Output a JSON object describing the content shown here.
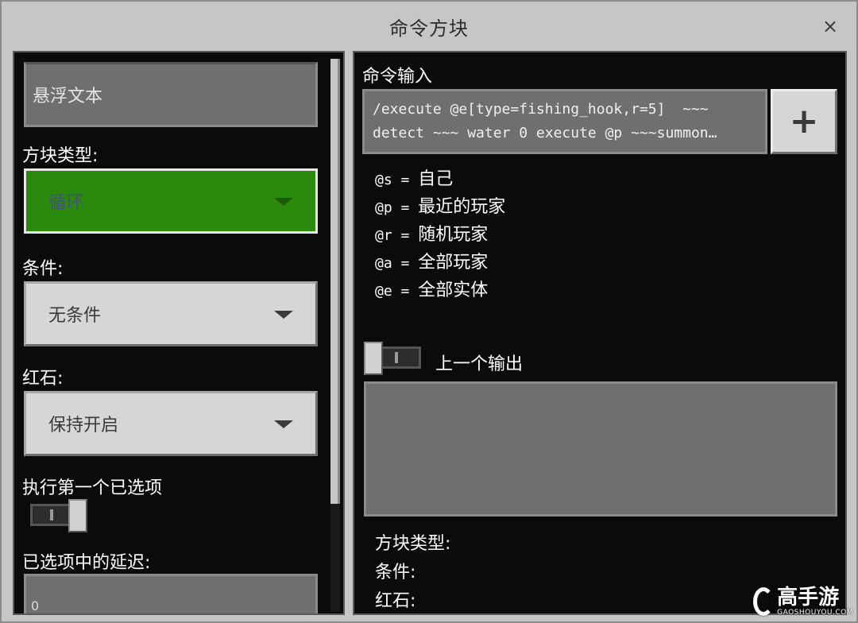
{
  "window": {
    "title": "命令方块",
    "close_glyph": "×"
  },
  "left": {
    "hover_text_placeholder": "悬浮文本",
    "block_type_label": "方块类型:",
    "block_type_value": "循环",
    "condition_label": "条件:",
    "condition_value": "无条件",
    "redstone_label": "红石:",
    "redstone_value": "保持开启",
    "execute_first_label": "执行第一个已选项",
    "execute_first_on": true,
    "delay_label": "已选项中的延迟:",
    "delay_value": "0"
  },
  "right": {
    "command_label": "命令输入",
    "command_text_line1": "/execute @e[type=fishing_hook,r=5]  ~~~",
    "command_text_line2": "detect ~~~ water 0 execute @p ~~~summon…",
    "plus_label": "+",
    "selectors": [
      {
        "code": "@s",
        "eq": " = ",
        "desc": "自己"
      },
      {
        "code": "@p",
        "eq": " = ",
        "desc": "最近的玩家"
      },
      {
        "code": "@r",
        "eq": " = ",
        "desc": "随机玩家"
      },
      {
        "code": "@a",
        "eq": " = ",
        "desc": "全部玩家"
      },
      {
        "code": "@e",
        "eq": " = ",
        "desc": "全部实体"
      }
    ],
    "previous_output_label": "上一个输出",
    "previous_output_on": false,
    "info_block_type": "方块类型:",
    "info_condition": "条件:",
    "info_redstone": "红石:"
  },
  "watermark": {
    "brand": "高手游",
    "url": "GAOSHOUYOU.COM"
  },
  "colors": {
    "panel_bg": "#0b0b0b",
    "window_bg": "#c6c6c6",
    "active_dropdown": "#2a8a0c",
    "input_bg": "#6f6f6f"
  }
}
